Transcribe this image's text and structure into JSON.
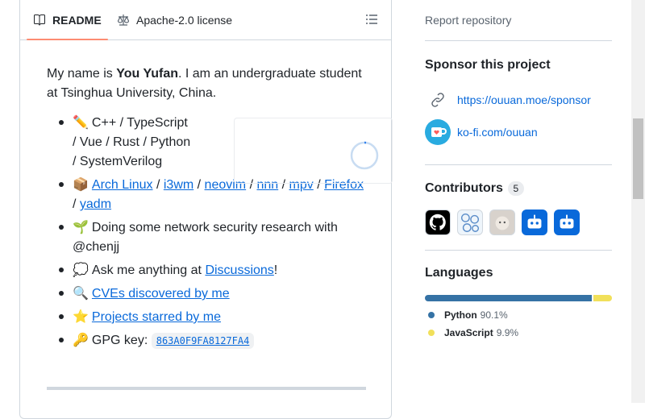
{
  "tabs": {
    "readme": "README",
    "license": "Apache-2.0 license"
  },
  "readme": {
    "intro_before": "My name is ",
    "intro_name": "You Yufan",
    "intro_after": ". I am an undergraduate student at Tsinghua University, China.",
    "items": {
      "languages": {
        "emoji": "✏️",
        "text": "C++ / TypeScript / Vue / Rust / Python / SystemVerilog"
      },
      "tools": {
        "emoji": "📦",
        "links": [
          "Arch Linux",
          "i3wm",
          "neovim",
          "nnn",
          "mpv",
          "Firefox",
          "yadm"
        ],
        "sep": " / "
      },
      "research": {
        "emoji": "🌱",
        "text": "Doing some network security research with @chenjj"
      },
      "ask": {
        "emoji": "💭",
        "before": "Ask me anything at ",
        "link": "Discussions",
        "after": "!"
      },
      "cves": {
        "emoji": "🔍",
        "link": "CVEs discovered by me"
      },
      "starred": {
        "emoji": "⭐",
        "link": "Projects starred by me"
      },
      "gpg": {
        "emoji": "🔑",
        "label": "GPG key: ",
        "key": "863A0F9FA8127FA4"
      }
    }
  },
  "sidebar": {
    "report": "Report repository",
    "sponsor": {
      "title": "Sponsor this project",
      "links": [
        "https://ouuan.moe/sponsor",
        "ko-fi.com/ouuan"
      ]
    },
    "contributors": {
      "title": "Contributors",
      "count": "5"
    },
    "languages": {
      "title": "Languages",
      "items": [
        {
          "name": "Python",
          "percent": "90.1%",
          "value": 90.1,
          "color": "#3572A5"
        },
        {
          "name": "JavaScript",
          "percent": "9.9%",
          "value": 9.9,
          "color": "#f1e05a"
        }
      ]
    }
  }
}
